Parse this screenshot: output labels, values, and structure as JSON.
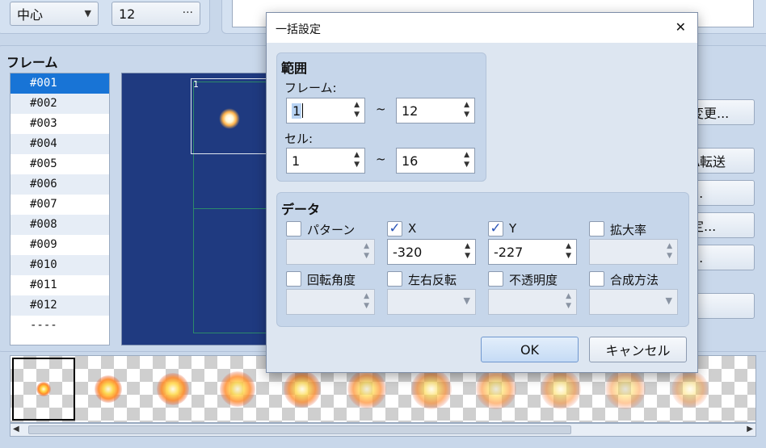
{
  "top": {
    "origin_value": "中心",
    "frames_value": "12",
    "ellipsis": "···"
  },
  "frames": {
    "title": "フレーム",
    "items": [
      "#001",
      "#002",
      "#003",
      "#004",
      "#005",
      "#006",
      "#007",
      "#008",
      "#009",
      "#010",
      "#011",
      "#012",
      "----"
    ],
    "selected_index": 0,
    "canvas_cell_label": "1"
  },
  "side_buttons": [
    "変更...",
    "A転送",
    "...",
    "定...",
    "...",
    ""
  ],
  "dialog": {
    "title": "一括設定",
    "close_glyph": "✕",
    "range": {
      "label": "範囲",
      "frame_label": "フレーム:",
      "frame_from": "1",
      "frame_to": "12",
      "tilde": "~",
      "cell_label": "セル:",
      "cell_from": "1",
      "cell_to": "16"
    },
    "data": {
      "label": "データ",
      "fields": [
        {
          "label": "パターン",
          "checked": false,
          "value": "",
          "type": "spin"
        },
        {
          "label": "X",
          "checked": true,
          "value": "-320",
          "type": "spin"
        },
        {
          "label": "Y",
          "checked": true,
          "value": "-227",
          "type": "spin"
        },
        {
          "label": "拡大率",
          "checked": false,
          "value": "",
          "type": "spin"
        },
        {
          "label": "回転角度",
          "checked": false,
          "value": "",
          "type": "spin"
        },
        {
          "label": "左右反転",
          "checked": false,
          "value": "",
          "type": "select"
        },
        {
          "label": "不透明度",
          "checked": false,
          "value": "",
          "type": "spin"
        },
        {
          "label": "合成方法",
          "checked": false,
          "value": "",
          "type": "select"
        }
      ]
    },
    "ok_label": "OK",
    "cancel_label": "キャンセル"
  },
  "glyphs": {
    "check": "✓",
    "spin_up": "▲",
    "spin_down": "▼",
    "dropdown": "▼",
    "scroll_left": "◀",
    "scroll_right": "▶"
  },
  "colors": {
    "accent": "#1874d6",
    "canvas_bg": "#1f3a80",
    "check": "#2c56b8"
  }
}
